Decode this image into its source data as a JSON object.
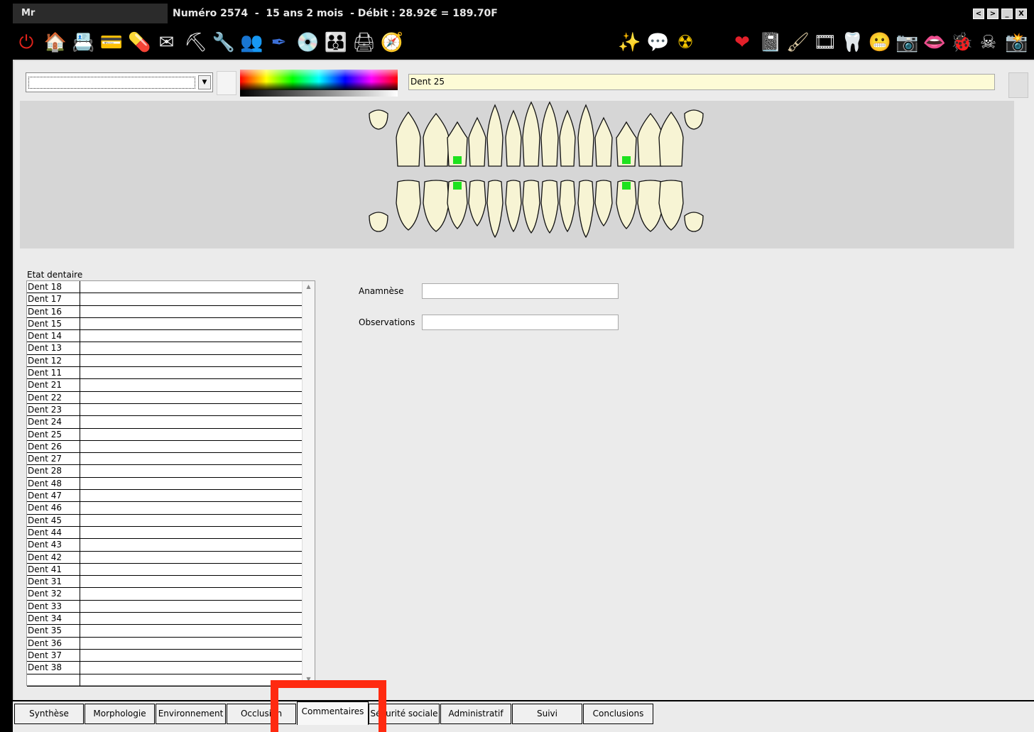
{
  "window": {
    "title_prefix": "Mr",
    "title": "Numéro 2574  -  15 ans 2 mois  - Débit : 28.92€ = 189.70F",
    "controls": [
      "<",
      ">",
      "_",
      "X"
    ]
  },
  "toolbar_left_icons": [
    {
      "name": "power-icon",
      "glyph": "⏻",
      "color": "#e0231b"
    },
    {
      "name": "home-icon",
      "glyph": "🏠",
      "color": "#e84a1a"
    },
    {
      "name": "scan-icon",
      "glyph": "📇",
      "color": "#3a6fd8"
    },
    {
      "name": "visa-card-icon",
      "glyph": "💳",
      "color": "#2d56b8"
    },
    {
      "name": "pill-icon",
      "glyph": "💊",
      "color": "#f4a21a"
    },
    {
      "name": "mail-icon",
      "glyph": "✉",
      "color": "#e8e8e8"
    },
    {
      "name": "worker-icon",
      "glyph": "⛏",
      "color": "#e8e8e8"
    },
    {
      "name": "drill-icon",
      "glyph": "🔧",
      "color": "#f2c300"
    },
    {
      "name": "users-icon",
      "glyph": "👥",
      "color": "#3fa23f"
    },
    {
      "name": "pen-icon",
      "glyph": "✒",
      "color": "#3c6fd6"
    },
    {
      "name": "cd-icon",
      "glyph": "💿",
      "color": "#e9c48e"
    },
    {
      "name": "team-icon",
      "glyph": "👪",
      "color": "#2f57c8"
    },
    {
      "name": "printer-icon",
      "glyph": "🖨",
      "color": "#d8d8d8"
    },
    {
      "name": "compass-icon",
      "glyph": "🧭",
      "color": "#d8d8d8"
    }
  ],
  "toolbar_middle_icons": [
    {
      "name": "magic-wand-icon",
      "glyph": "✨",
      "color": "#f2e36a"
    },
    {
      "name": "speech-bubble-icon",
      "glyph": "💬",
      "color": "#f7f0c0"
    },
    {
      "name": "radiation-icon",
      "glyph": "☢",
      "color": "#f4c500"
    }
  ],
  "toolbar_right_icons": [
    {
      "name": "heart-icon",
      "glyph": "❤",
      "color": "#e3202a"
    },
    {
      "name": "slate-icon",
      "glyph": "📓",
      "color": "#3a3a1a"
    },
    {
      "name": "brush-icon",
      "glyph": "🖌",
      "color": "#d8c6a0"
    },
    {
      "name": "film-reel-icon",
      "glyph": "🎞",
      "color": "#e8e8e8"
    },
    {
      "name": "tooth-icon",
      "glyph": "🦷",
      "color": "#e8e8e8"
    },
    {
      "name": "teeth-icon",
      "glyph": "😬",
      "color": "#e84040"
    },
    {
      "name": "camera-box-icon",
      "glyph": "📷",
      "color": "#cfcfcf"
    },
    {
      "name": "lips-icon",
      "glyph": "👄",
      "color": "#e0202a"
    },
    {
      "name": "bug-icon",
      "glyph": "🐞",
      "color": "#e02a10"
    },
    {
      "name": "skull-icon",
      "glyph": "☠",
      "color": "#e8e8e8"
    },
    {
      "name": "camera-icon",
      "glyph": "📸",
      "color": "#cfcfcf"
    }
  ],
  "selector": {
    "current_tooth": "Dent 25"
  },
  "teeth_marked": [
    "Dent 15",
    "Dent 25",
    "Dent 45",
    "Dent 35"
  ],
  "etat": {
    "title": "Etat dentaire",
    "rows": [
      {
        "tooth": "Dent 18",
        "state": ""
      },
      {
        "tooth": "Dent 17",
        "state": ""
      },
      {
        "tooth": "Dent 16",
        "state": ""
      },
      {
        "tooth": "Dent 15",
        "state": ""
      },
      {
        "tooth": "Dent 14",
        "state": ""
      },
      {
        "tooth": "Dent 13",
        "state": ""
      },
      {
        "tooth": "Dent 12",
        "state": ""
      },
      {
        "tooth": "Dent 11",
        "state": ""
      },
      {
        "tooth": "Dent 21",
        "state": ""
      },
      {
        "tooth": "Dent 22",
        "state": ""
      },
      {
        "tooth": "Dent 23",
        "state": ""
      },
      {
        "tooth": "Dent 24",
        "state": ""
      },
      {
        "tooth": "Dent 25",
        "state": ""
      },
      {
        "tooth": "Dent 26",
        "state": ""
      },
      {
        "tooth": "Dent 27",
        "state": ""
      },
      {
        "tooth": "Dent 28",
        "state": ""
      },
      {
        "tooth": "Dent 48",
        "state": ""
      },
      {
        "tooth": "Dent 47",
        "state": ""
      },
      {
        "tooth": "Dent 46",
        "state": ""
      },
      {
        "tooth": "Dent 45",
        "state": ""
      },
      {
        "tooth": "Dent 44",
        "state": ""
      },
      {
        "tooth": "Dent 43",
        "state": ""
      },
      {
        "tooth": "Dent 42",
        "state": ""
      },
      {
        "tooth": "Dent 41",
        "state": ""
      },
      {
        "tooth": "Dent 31",
        "state": ""
      },
      {
        "tooth": "Dent 32",
        "state": ""
      },
      {
        "tooth": "Dent 33",
        "state": ""
      },
      {
        "tooth": "Dent 34",
        "state": ""
      },
      {
        "tooth": "Dent 35",
        "state": ""
      },
      {
        "tooth": "Dent 36",
        "state": ""
      },
      {
        "tooth": "Dent 37",
        "state": ""
      },
      {
        "tooth": "Dent 38",
        "state": ""
      },
      {
        "tooth": "",
        "state": ""
      }
    ]
  },
  "fields": {
    "anamnese_label": "Anamnèse",
    "anamnese_value": "",
    "observations_label": "Observations",
    "observations_value": ""
  },
  "tabs": [
    {
      "label": "Synthèse",
      "active": false
    },
    {
      "label": "Morphologie",
      "active": false
    },
    {
      "label": "Environnement",
      "active": false
    },
    {
      "label": "Occlusion",
      "active": false
    },
    {
      "label": "Commentaires",
      "active": true
    },
    {
      "label": "Sécurité sociale",
      "active": false
    },
    {
      "label": "Administratif",
      "active": false
    },
    {
      "label": "Suivi",
      "active": false
    },
    {
      "label": "Conclusions",
      "active": false
    }
  ],
  "colors": {
    "tooth_fill": "#f7f4d4",
    "marker_green": "#1ee21e",
    "highlight_red": "#ff2a10"
  }
}
